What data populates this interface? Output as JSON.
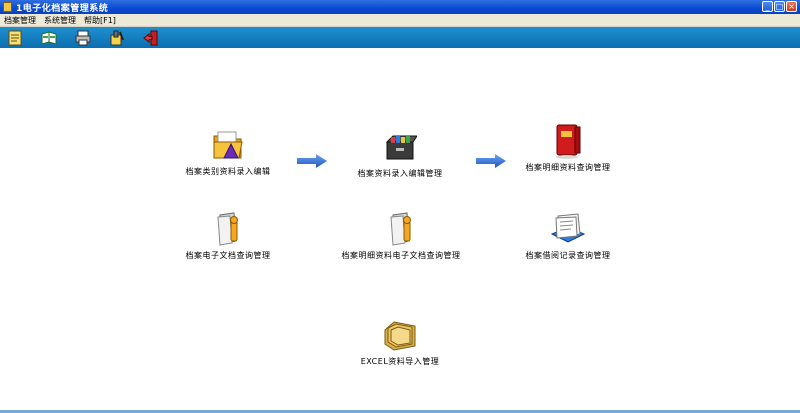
{
  "window": {
    "title": "1电子化档案管理系统"
  },
  "menu": [
    "档案管理",
    "系统管理",
    "帮助[F1]"
  ],
  "toolbar": [
    {
      "icon": "document-icon"
    },
    {
      "icon": "book-icon"
    },
    {
      "icon": "printer-icon"
    },
    {
      "icon": "tools-icon"
    },
    {
      "icon": "exit-door-icon"
    }
  ],
  "modules": {
    "category_entry": "档案类别资料录入编辑",
    "file_entry": "档案资料录入编辑管理",
    "detail_query": "档案明细资料查询管理",
    "e_doc_query": "档案电子文档查询管理",
    "detail_e_doc_query": "档案明细资料电子文档查询管理",
    "borrow_query": "档案借阅记录查询管理",
    "excel_import": "EXCEL资料导入管理"
  },
  "colors": {
    "titlebar": "#0a4ad0",
    "toolbar": "#0b6fb0",
    "arrow": "#2f6fd6"
  }
}
